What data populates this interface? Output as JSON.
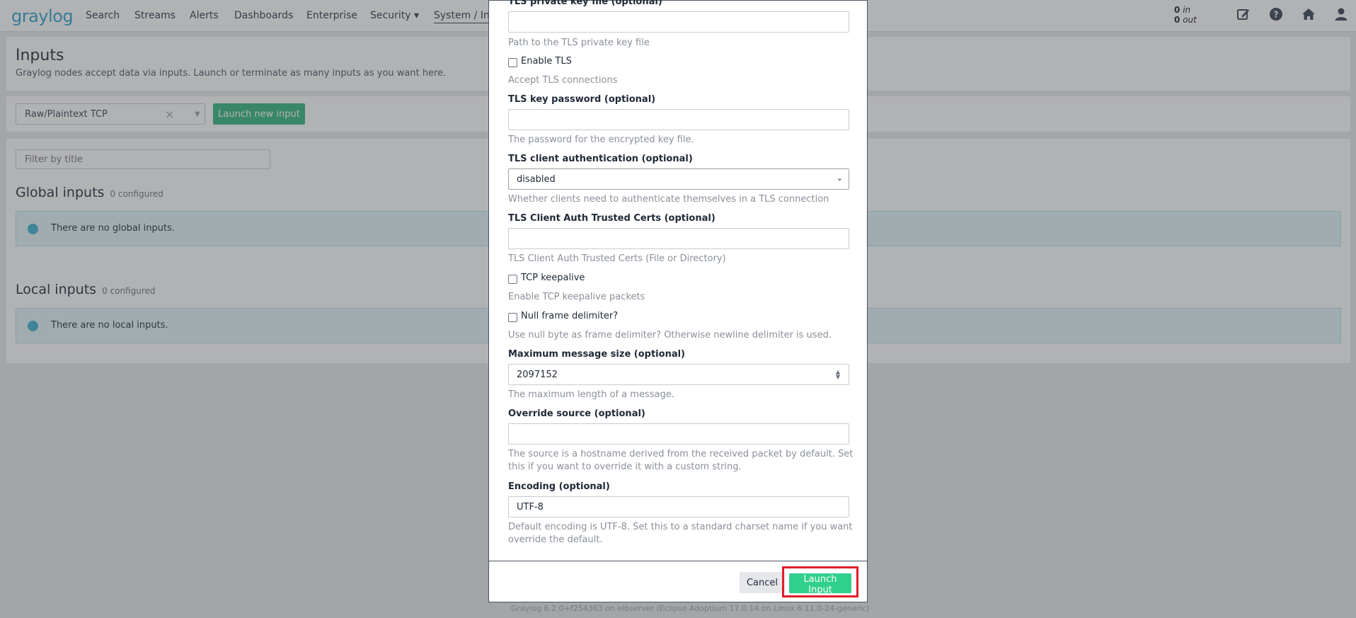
{
  "navbar": {
    "logo": "graylog",
    "items": [
      {
        "label": "Search"
      },
      {
        "label": "Streams"
      },
      {
        "label": "Alerts"
      },
      {
        "label": "Dashboards"
      },
      {
        "label": "Enterprise"
      },
      {
        "label": "Security ▾"
      },
      {
        "label": "System / Inp"
      }
    ],
    "throughput": {
      "in_count": "0",
      "in_label": "in",
      "out_count": "0",
      "out_label": "out"
    },
    "icons": [
      "edit-icon",
      "help-icon",
      "home-icon",
      "user-icon"
    ]
  },
  "page": {
    "title": "Inputs",
    "subtitle": "Graylog nodes accept data via inputs. Launch or terminate as many inputs as you want here.",
    "input_type_select": {
      "value": "Raw/Plaintext TCP"
    },
    "launch_new_label": "Launch new input",
    "filter_placeholder": "Filter by title",
    "global": {
      "title": "Global inputs",
      "count": "0 configured",
      "empty": "There are no global inputs."
    },
    "local": {
      "title": "Local inputs",
      "count": "0 configured",
      "empty": "There are no local inputs."
    },
    "footer": "Graylog 6.2.0+f254363 on elbserver (Eclipse Adoptium 17.0.14 on Linux 6.11.0-24-generic)"
  },
  "modal": {
    "fields": {
      "tls_private_key_file": {
        "label": "TLS private key file (optional)",
        "value": "",
        "help": "Path to the TLS private key file"
      },
      "enable_tls": {
        "label": "Enable TLS",
        "help": "Accept TLS connections"
      },
      "tls_key_password": {
        "label": "TLS key password (optional)",
        "value": "",
        "help": "The password for the encrypted key file."
      },
      "tls_client_auth": {
        "label": "TLS client authentication (optional)",
        "value": "disabled",
        "help": "Whether clients need to authenticate themselves in a TLS connection"
      },
      "tls_client_auth_certs": {
        "label": "TLS Client Auth Trusted Certs (optional)",
        "value": "",
        "help": "TLS Client Auth Trusted Certs (File or Directory)"
      },
      "tcp_keepalive": {
        "label": "TCP keepalive",
        "help": "Enable TCP keepalive packets"
      },
      "null_frame_delimiter": {
        "label": "Null frame delimiter?",
        "help": "Use null byte as frame delimiter? Otherwise newline delimiter is used."
      },
      "max_message_size": {
        "label": "Maximum message size (optional)",
        "value": "2097152",
        "help": "The maximum length of a message."
      },
      "override_source": {
        "label": "Override source (optional)",
        "value": "",
        "help": "The source is a hostname derived from the received packet by default. Set this if you want to override it with a custom string."
      },
      "encoding": {
        "label": "Encoding (optional)",
        "value": "UTF-8",
        "help": "Default encoding is UTF-8. Set this to a standard charset name if you want override the default."
      }
    },
    "cancel_label": "Cancel",
    "launch_label": "Launch Input"
  }
}
